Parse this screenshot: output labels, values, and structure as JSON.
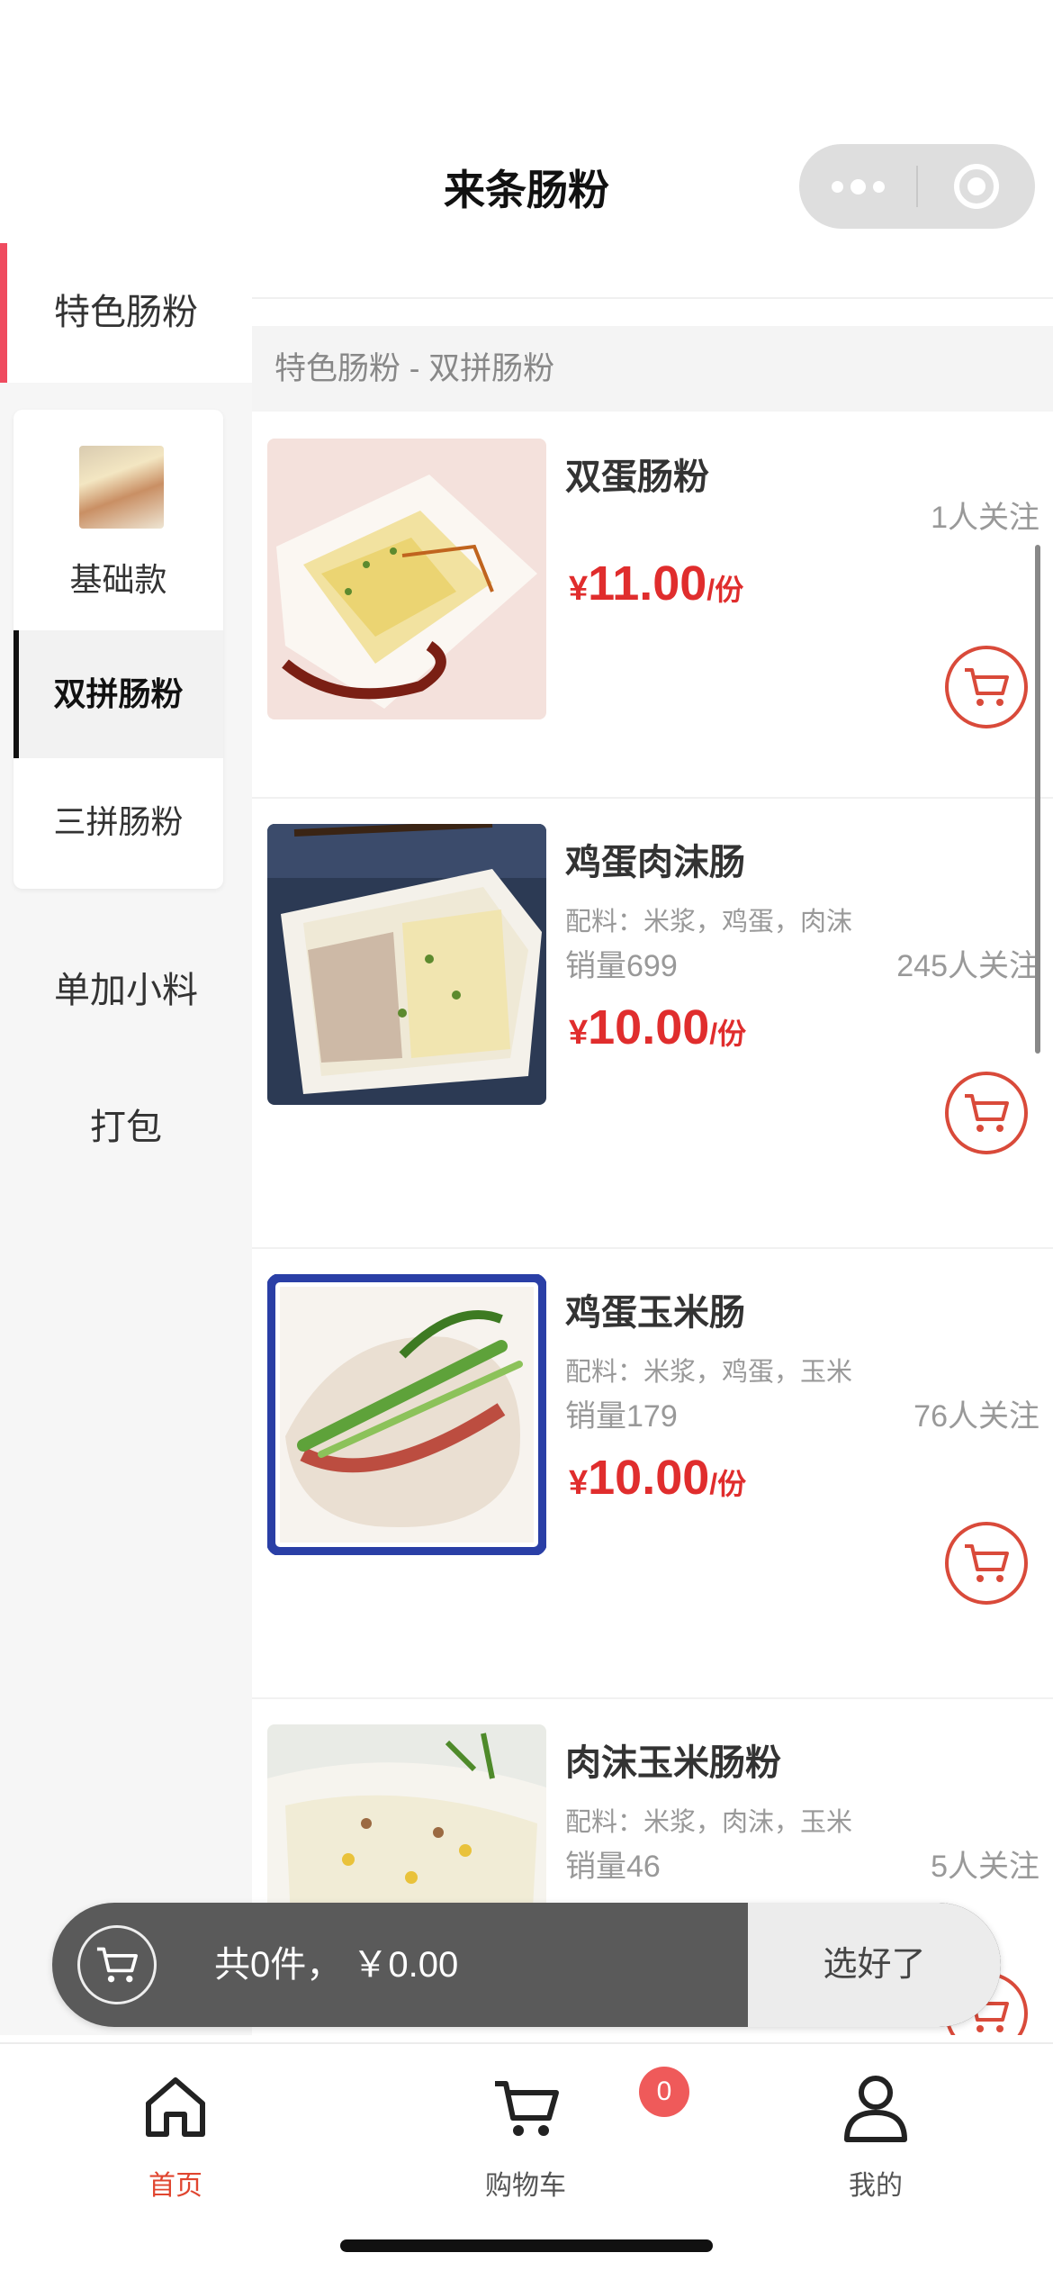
{
  "header": {
    "title": "来条肠粉"
  },
  "sidebar": {
    "categories": [
      "特色肠粉",
      "单加小料",
      "打包"
    ],
    "subcategories": [
      "基础款",
      "双拼肠粉",
      "三拼肠粉"
    ]
  },
  "main": {
    "section_title": "特色肠粉 - 双拼肠粉",
    "products": [
      {
        "name": "双蛋肠粉",
        "ingredients": "",
        "sales": "",
        "followers": "1人关注",
        "currency": "¥",
        "price": "11.00",
        "unit": "/份"
      },
      {
        "name": "鸡蛋肉沫肠",
        "ingredients": "配料：米浆，鸡蛋，肉沫",
        "sales": "销量699",
        "followers": "245人关注",
        "currency": "¥",
        "price": "10.00",
        "unit": "/份"
      },
      {
        "name": "鸡蛋玉米肠",
        "ingredients": "配料：米浆，鸡蛋，玉米",
        "sales": "销量179",
        "followers": "76人关注",
        "currency": "¥",
        "price": "10.00",
        "unit": "/份"
      },
      {
        "name": "肉沫玉米肠粉",
        "ingredients": "配料：米浆，肉沫，玉米",
        "sales": "销量46",
        "followers": "5人关注",
        "currency": "¥",
        "price": "",
        "unit": ""
      }
    ]
  },
  "cart": {
    "summary": "共0件， ￥0.00",
    "confirm_label": "选好了"
  },
  "tabbar": {
    "tabs": [
      {
        "label": "首页",
        "icon": "home-icon",
        "active": true
      },
      {
        "label": "购物车",
        "icon": "cart-icon",
        "active": false
      },
      {
        "label": "我的",
        "icon": "user-icon",
        "active": false
      }
    ],
    "cart_badge": "0"
  },
  "colors": {
    "accent": "#e02d2d",
    "tab_active": "#e0452f",
    "sidebar_marker": "#ef4b5f",
    "badge": "#ef5a5a"
  }
}
